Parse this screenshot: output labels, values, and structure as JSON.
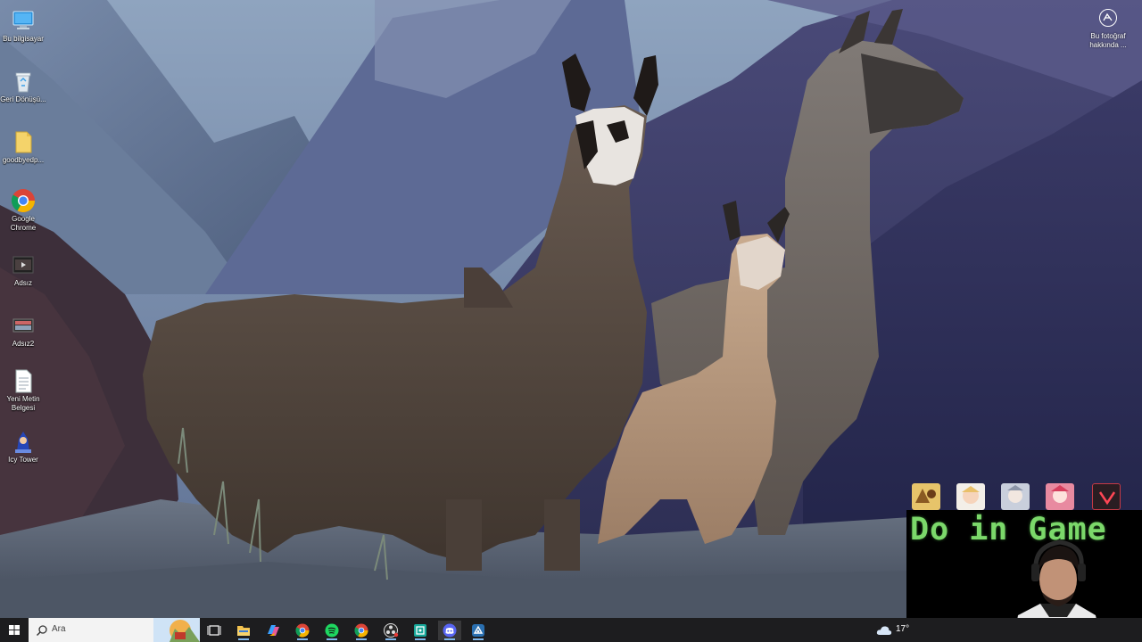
{
  "desktop": {
    "icons": [
      {
        "label": "Bu bilgisayar",
        "icon": "computer-icon"
      },
      {
        "label": "Geri Dönüşü...",
        "icon": "recycle-bin-icon"
      },
      {
        "label": "goodbyedp...",
        "icon": "folder-icon"
      },
      {
        "label": "Google Chrome",
        "icon": "chrome-icon"
      },
      {
        "label": "Adsız",
        "icon": "video-file-icon"
      },
      {
        "label": "Adsız2",
        "icon": "video-file-icon"
      },
      {
        "label": "Yeni Metin Belgesi",
        "icon": "text-document-icon"
      },
      {
        "label": "Icy Tower",
        "icon": "icy-tower-icon"
      }
    ],
    "photo_info": {
      "label": "Bu fotoğraf hakkında ...",
      "icon": "camera-icon"
    }
  },
  "overlay": {
    "title": "Do in Game",
    "title_color": "#7bd86a",
    "icons": [
      "game-icon-1",
      "game-icon-2",
      "game-icon-3",
      "game-icon-4",
      "valorant-icon"
    ]
  },
  "taskbar": {
    "search_placeholder": "Ara",
    "apps": [
      "task-view-icon",
      "file-explorer-icon",
      "copilot-icon",
      "chrome-icon",
      "spotify-icon",
      "chrome-icon-2",
      "obs-icon",
      "app-icon",
      "discord-icon",
      "steam-icon"
    ],
    "weather_text": "17°"
  }
}
